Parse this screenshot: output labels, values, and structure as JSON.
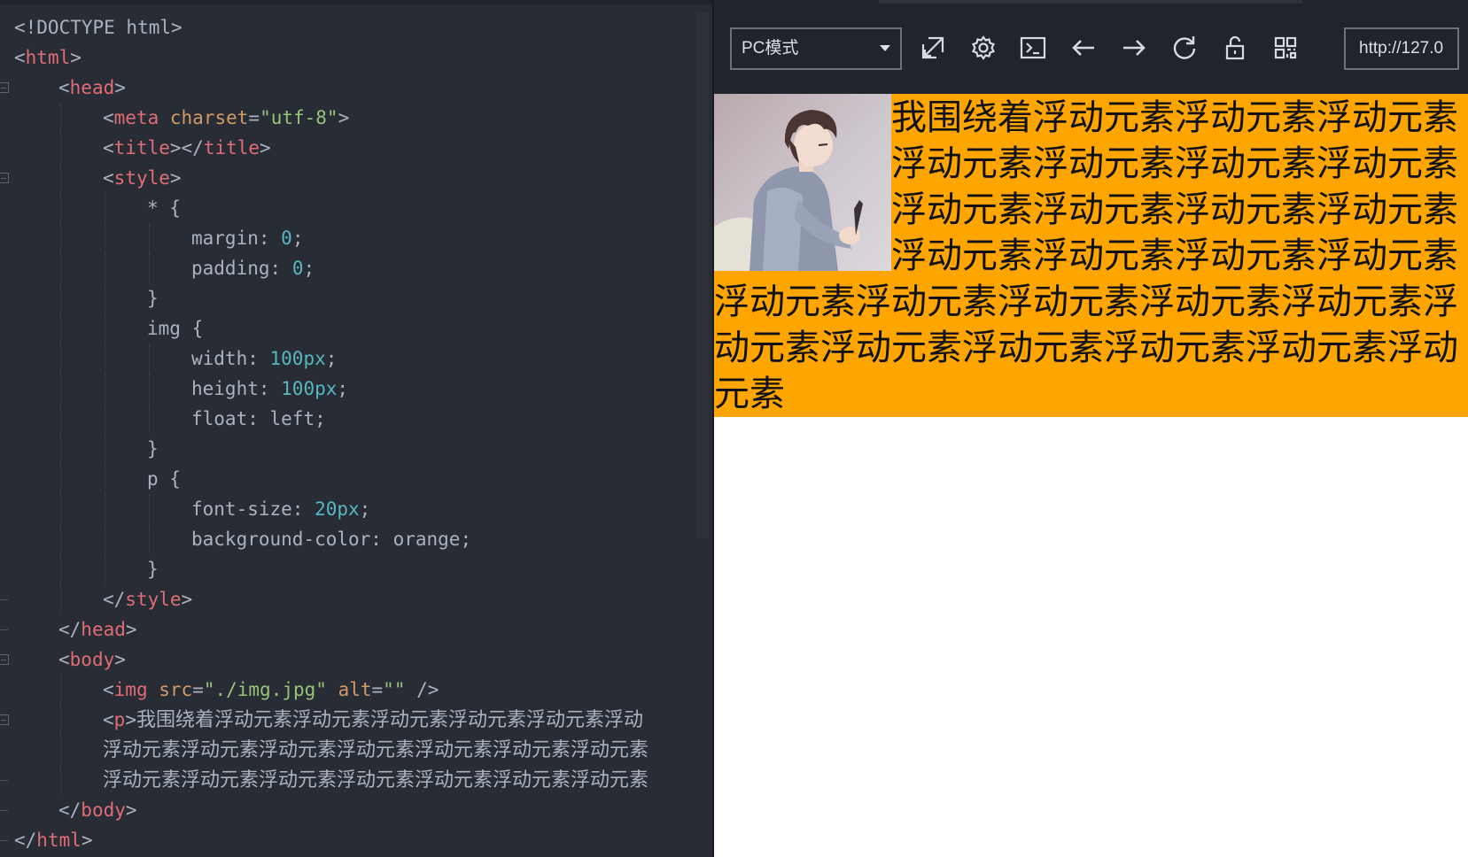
{
  "editor": {
    "lines": [
      [
        [
          "punc",
          "<!DOCTYPE html>"
        ]
      ],
      [
        [
          "punc",
          "<"
        ],
        [
          "tag",
          "html"
        ],
        [
          "punc",
          ">"
        ]
      ],
      [
        [
          "punc",
          "<"
        ],
        [
          "tag",
          "head"
        ],
        [
          "punc",
          ">"
        ]
      ],
      [
        [
          "punc",
          "<"
        ],
        [
          "tag",
          "meta"
        ],
        [
          "punc",
          " "
        ],
        [
          "attr",
          "charset"
        ],
        [
          "punc",
          "="
        ],
        [
          "str",
          "\"utf-8\""
        ],
        [
          "punc",
          ">"
        ]
      ],
      [
        [
          "punc",
          "<"
        ],
        [
          "tag",
          "title"
        ],
        [
          "punc",
          "></"
        ],
        [
          "tag",
          "title"
        ],
        [
          "punc",
          ">"
        ]
      ],
      [
        [
          "punc",
          "<"
        ],
        [
          "tag",
          "style"
        ],
        [
          "punc",
          ">"
        ]
      ],
      [
        [
          "sel",
          "* {"
        ]
      ],
      [
        [
          "prop",
          "margin"
        ],
        [
          "punc",
          ": "
        ],
        [
          "num",
          "0"
        ],
        [
          "punc",
          ";"
        ]
      ],
      [
        [
          "prop",
          "padding"
        ],
        [
          "punc",
          ": "
        ],
        [
          "num",
          "0"
        ],
        [
          "punc",
          ";"
        ]
      ],
      [
        [
          "punc",
          "}"
        ]
      ],
      [
        [
          "sel",
          "img {"
        ]
      ],
      [
        [
          "prop",
          "width"
        ],
        [
          "punc",
          ": "
        ],
        [
          "num",
          "100px"
        ],
        [
          "punc",
          ";"
        ]
      ],
      [
        [
          "prop",
          "height"
        ],
        [
          "punc",
          ": "
        ],
        [
          "num",
          "100px"
        ],
        [
          "punc",
          ";"
        ]
      ],
      [
        [
          "prop",
          "float"
        ],
        [
          "punc",
          ": "
        ],
        [
          "val",
          "left"
        ],
        [
          "punc",
          ";"
        ]
      ],
      [
        [
          "punc",
          "}"
        ]
      ],
      [
        [
          "sel",
          "p {"
        ]
      ],
      [
        [
          "prop",
          "font-size"
        ],
        [
          "punc",
          ": "
        ],
        [
          "num",
          "20px"
        ],
        [
          "punc",
          ";"
        ]
      ],
      [
        [
          "prop",
          "background-color"
        ],
        [
          "punc",
          ": "
        ],
        [
          "val",
          "orange"
        ],
        [
          "punc",
          ";"
        ]
      ],
      [
        [
          "punc",
          "}"
        ]
      ],
      [
        [
          "punc",
          "</"
        ],
        [
          "tag",
          "style"
        ],
        [
          "punc",
          ">"
        ]
      ],
      [
        [
          "punc",
          "</"
        ],
        [
          "tag",
          "head"
        ],
        [
          "punc",
          ">"
        ]
      ],
      [
        [
          "punc",
          "<"
        ],
        [
          "tag",
          "body"
        ],
        [
          "punc",
          ">"
        ]
      ],
      [
        [
          "punc",
          "<"
        ],
        [
          "tag",
          "img"
        ],
        [
          "punc",
          " "
        ],
        [
          "attr",
          "src"
        ],
        [
          "punc",
          "="
        ],
        [
          "str",
          "\"./img.jpg\""
        ],
        [
          "punc",
          " "
        ],
        [
          "attr",
          "alt"
        ],
        [
          "punc",
          "="
        ],
        [
          "str",
          "\"\""
        ],
        [
          "punc",
          " />"
        ]
      ],
      [
        [
          "punc",
          "<"
        ],
        [
          "tag",
          "p"
        ],
        [
          "punc",
          ">"
        ],
        [
          "text",
          "我围绕着浮动元素浮动元素浮动元素浮动元素浮动元素浮动"
        ]
      ],
      [
        [
          "text",
          "浮动元素浮动元素浮动元素浮动元素浮动元素浮动元素浮动元素"
        ]
      ],
      [
        [
          "text",
          "浮动元素浮动元素浮动元素浮动元素浮动元素浮动元素浮动元素"
        ]
      ],
      [
        [
          "punc",
          "</"
        ],
        [
          "tag",
          "body"
        ],
        [
          "punc",
          ">"
        ]
      ],
      [
        [
          "punc",
          "</"
        ],
        [
          "tag",
          "html"
        ],
        [
          "punc",
          ">"
        ]
      ]
    ],
    "indent": [
      0,
      0,
      1,
      2,
      2,
      2,
      3,
      4,
      4,
      3,
      3,
      4,
      4,
      4,
      3,
      3,
      4,
      4,
      3,
      2,
      1,
      1,
      2,
      2,
      2,
      2,
      1,
      0
    ],
    "folds": [
      0,
      0,
      1,
      0,
      0,
      1,
      0,
      0,
      0,
      0,
      0,
      0,
      0,
      0,
      0,
      0,
      0,
      0,
      0,
      2,
      2,
      1,
      0,
      1,
      0,
      2,
      2,
      2
    ]
  },
  "preview": {
    "mode_select": "PC模式",
    "url": "http://127.0",
    "toolbar_icons": [
      "open-external-icon",
      "gear-icon",
      "terminal-icon",
      "arrow-left-icon",
      "arrow-right-icon",
      "refresh-icon",
      "lock-icon",
      "qr-code-icon"
    ],
    "paragraph": "我围绕着浮动元素浮动元素浮动元素浮动元素浮动元素浮动元素浮动元素浮动元素浮动元素浮动元素浮动元素浮动元素浮动元素浮动元素浮动元素 浮动元素浮动元素浮动元素浮动元素浮动元素浮动元素浮动元素浮动元素浮动元素浮动元素浮动元素",
    "image_alt": ""
  }
}
